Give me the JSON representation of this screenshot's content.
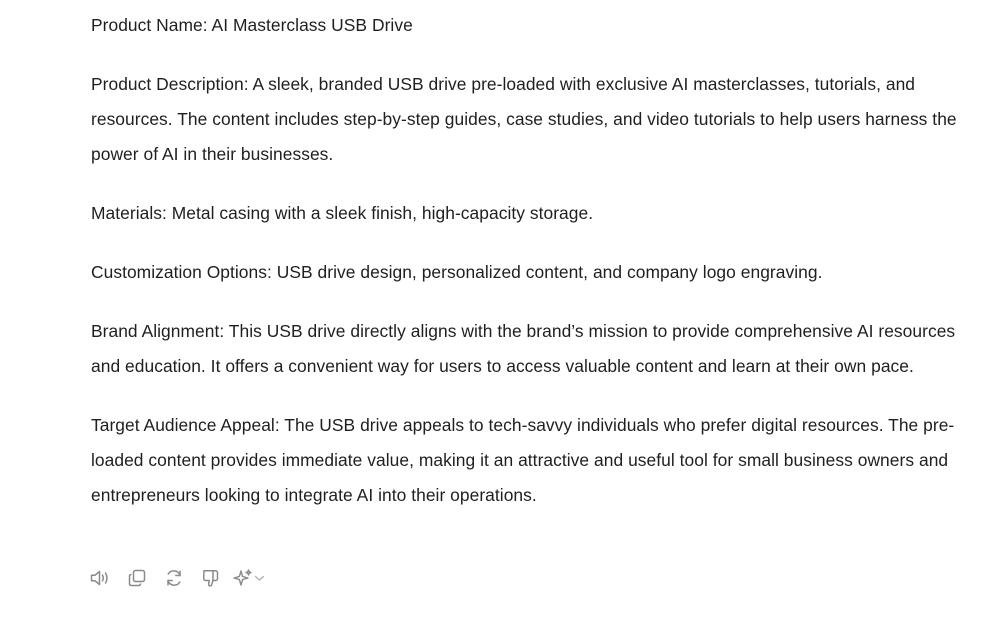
{
  "response": {
    "paragraphs": [
      "Product Name: AI Masterclass USB Drive",
      "Product Description: A sleek, branded USB drive pre-loaded with exclusive AI masterclasses, tutorials, and resources. The content includes step-by-step guides, case studies, and video tutorials to help users harness the power of AI in their businesses.",
      "Materials: Metal casing with a sleek finish, high-capacity storage.",
      "Customization Options: USB drive design, personalized content, and company logo engraving.",
      "Brand Alignment: This USB drive directly aligns with the brand’s mission to provide comprehensive AI resources and education. It offers a convenient way for users to access valuable content and learn at their own pace.",
      "Target Audience Appeal: The USB drive appeals to tech-savvy individuals who prefer digital resources. The pre-loaded content provides immediate value, making it an attractive and useful tool for small business owners and entrepreneurs looking to integrate AI into their operations."
    ]
  },
  "actions": [
    {
      "icon": "speaker-icon"
    },
    {
      "icon": "copy-icon"
    },
    {
      "icon": "regenerate-icon"
    },
    {
      "icon": "thumbs-down-icon"
    },
    {
      "icon": "sparkle-icon"
    }
  ],
  "colors": {
    "text": "#1f1f1f",
    "icon": "#8a8a8a",
    "background": "#ffffff"
  }
}
